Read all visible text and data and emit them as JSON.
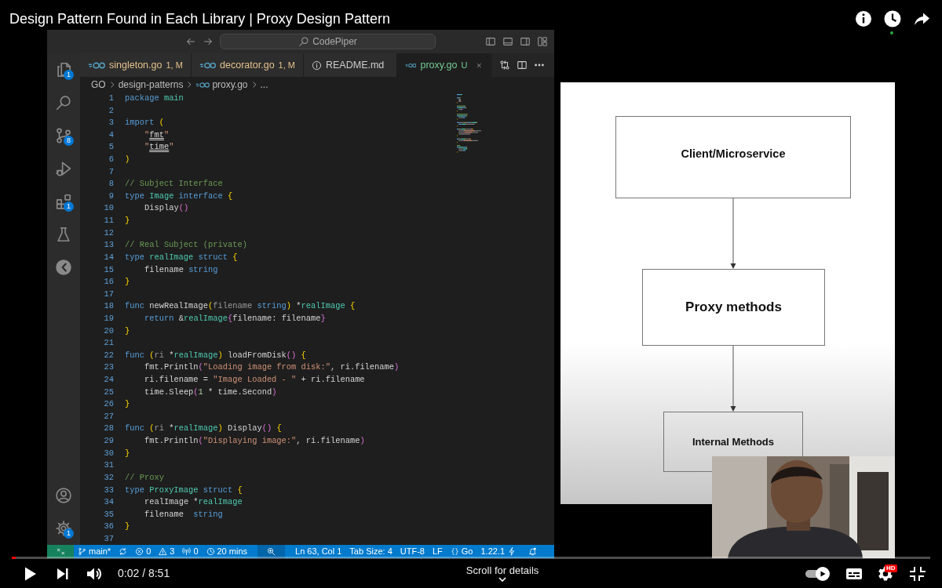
{
  "video": {
    "title": "Design Pattern Found in Each Library | Proxy Design Pattern"
  },
  "editor": {
    "search": "CodePiper",
    "tabs": [
      {
        "label": "singleton.go",
        "kind": "go",
        "decoration": "1, M",
        "color": "#e2c08d",
        "selected": false
      },
      {
        "label": "decorator.go",
        "kind": "go",
        "decoration": "1, M",
        "color": "#e2c08d",
        "selected": false
      },
      {
        "label": "README.md",
        "kind": "markdown",
        "color": "#cccccc",
        "selected": false
      },
      {
        "label": "proxy.go",
        "kind": "go",
        "decoration": "U",
        "color": "#73c991",
        "selected": true
      }
    ],
    "breadcrumbs": [
      {
        "label": "GO",
        "kind": "folder"
      },
      {
        "label": "design-patterns",
        "kind": "folder"
      },
      {
        "label": "proxy.go",
        "kind": "file"
      },
      {
        "label": "...",
        "kind": "symbol"
      }
    ],
    "activity_top": [
      {
        "kind": "explorer",
        "badge": "1"
      },
      {
        "kind": "search"
      },
      {
        "kind": "source-control",
        "badge": "8"
      },
      {
        "kind": "debug"
      },
      {
        "kind": "extensions",
        "badge": "1"
      },
      {
        "kind": "testing"
      },
      {
        "kind": "timeline"
      }
    ],
    "activity_bottom": [
      {
        "kind": "account"
      },
      {
        "kind": "settings",
        "badge": "1"
      }
    ],
    "lines": [
      {
        "n": "1",
        "t": [
          {
            "kind": "keyword",
            "text": "package "
          },
          {
            "kind": "type",
            "text": "main"
          }
        ]
      },
      {
        "n": "2"
      },
      {
        "n": "3",
        "t": [
          {
            "kind": "keyword",
            "text": "import "
          },
          {
            "kind": "bracket",
            "text": "("
          }
        ]
      },
      {
        "n": "4",
        "indent": true,
        "t": [
          {
            "kind": "string",
            "text": "\""
          },
          {
            "kind": "module",
            "text": "fmt"
          },
          {
            "kind": "string",
            "text": "\""
          }
        ]
      },
      {
        "n": "5",
        "indent": true,
        "t": [
          {
            "kind": "string",
            "text": "\""
          },
          {
            "kind": "module",
            "text": "time"
          },
          {
            "kind": "string",
            "text": "\""
          }
        ]
      },
      {
        "n": "6",
        "t": [
          {
            "kind": "bracket",
            "text": ")"
          }
        ]
      },
      {
        "n": "7"
      },
      {
        "n": "8",
        "t": [
          {
            "kind": "comment",
            "text": "// Subject Interface"
          }
        ]
      },
      {
        "n": "9",
        "t": [
          {
            "kind": "keyword",
            "text": "type "
          },
          {
            "kind": "type",
            "text": "Image "
          },
          {
            "kind": "keyword",
            "text": "interface "
          },
          {
            "kind": "bracket",
            "text": "{"
          }
        ]
      },
      {
        "n": "10",
        "indent": true,
        "t": [
          {
            "kind": "plain",
            "text": "Display"
          },
          {
            "kind": "paren",
            "text": "()"
          }
        ]
      },
      {
        "n": "11",
        "t": [
          {
            "kind": "bracket",
            "text": "}"
          }
        ]
      },
      {
        "n": "12"
      },
      {
        "n": "13",
        "t": [
          {
            "kind": "comment",
            "text": "// Real Subject (private)"
          }
        ]
      },
      {
        "n": "14",
        "t": [
          {
            "kind": "keyword",
            "text": "type "
          },
          {
            "kind": "type",
            "text": "realImage "
          },
          {
            "kind": "keyword",
            "text": "struct "
          },
          {
            "kind": "bracket",
            "text": "{"
          }
        ]
      },
      {
        "n": "15",
        "indent": true,
        "t": [
          {
            "kind": "plain",
            "text": "filename "
          },
          {
            "kind": "keyword",
            "text": "string"
          }
        ]
      },
      {
        "n": "16",
        "t": [
          {
            "kind": "bracket",
            "text": "}"
          }
        ]
      },
      {
        "n": "17"
      },
      {
        "n": "18",
        "t": [
          {
            "kind": "keyword",
            "text": "func "
          },
          {
            "kind": "plain",
            "text": "newRealImage"
          },
          {
            "kind": "bracket",
            "text": "("
          },
          {
            "kind": "param",
            "text": "filename "
          },
          {
            "kind": "keyword",
            "text": "string"
          },
          {
            "kind": "bracket",
            "text": ")"
          },
          {
            "kind": "plain",
            "text": " *"
          },
          {
            "kind": "type",
            "text": "realImage "
          },
          {
            "kind": "bracket",
            "text": "{"
          }
        ]
      },
      {
        "n": "19",
        "indent": true,
        "t": [
          {
            "kind": "keyword",
            "text": "return "
          },
          {
            "kind": "plain",
            "text": "&"
          },
          {
            "kind": "type",
            "text": "realImage"
          },
          {
            "kind": "paren",
            "text": "{"
          },
          {
            "kind": "plain",
            "text": "filename: filename"
          },
          {
            "kind": "paren",
            "text": "}"
          }
        ]
      },
      {
        "n": "20",
        "t": [
          {
            "kind": "bracket",
            "text": "}"
          }
        ]
      },
      {
        "n": "21"
      },
      {
        "n": "22",
        "t": [
          {
            "kind": "keyword",
            "text": "func "
          },
          {
            "kind": "bracket",
            "text": "("
          },
          {
            "kind": "param",
            "text": "ri "
          },
          {
            "kind": "plain",
            "text": "*"
          },
          {
            "kind": "type",
            "text": "realImage"
          },
          {
            "kind": "bracket",
            "text": ")"
          },
          {
            "kind": "plain",
            "text": " loadFromDisk"
          },
          {
            "kind": "paren",
            "text": "()"
          },
          {
            "kind": "bracket",
            "text": " {"
          }
        ]
      },
      {
        "n": "23",
        "indent": true,
        "t": [
          {
            "kind": "plain",
            "text": "fmt.Println"
          },
          {
            "kind": "paren",
            "text": "("
          },
          {
            "kind": "string",
            "text": "\"Loading image from disk:\""
          },
          {
            "kind": "plain",
            "text": ", ri.filename"
          },
          {
            "kind": "paren",
            "text": ")"
          }
        ]
      },
      {
        "n": "24",
        "indent": true,
        "t": [
          {
            "kind": "plain",
            "text": "ri.filename = "
          },
          {
            "kind": "string",
            "text": "\"Image Loaded - \""
          },
          {
            "kind": "plain",
            "text": " + ri.filename"
          }
        ]
      },
      {
        "n": "25",
        "indent": true,
        "t": [
          {
            "kind": "plain",
            "text": "time.Sleep"
          },
          {
            "kind": "paren",
            "text": "("
          },
          {
            "kind": "number",
            "text": "1"
          },
          {
            "kind": "plain",
            "text": " * time.Second"
          },
          {
            "kind": "paren",
            "text": ")"
          }
        ]
      },
      {
        "n": "26",
        "t": [
          {
            "kind": "bracket",
            "text": "}"
          }
        ]
      },
      {
        "n": "27"
      },
      {
        "n": "28",
        "t": [
          {
            "kind": "keyword",
            "text": "func "
          },
          {
            "kind": "bracket",
            "text": "("
          },
          {
            "kind": "param",
            "text": "ri "
          },
          {
            "kind": "plain",
            "text": "*"
          },
          {
            "kind": "type",
            "text": "realImage"
          },
          {
            "kind": "bracket",
            "text": ")"
          },
          {
            "kind": "plain",
            "text": " Display"
          },
          {
            "kind": "paren",
            "text": "()"
          },
          {
            "kind": "bracket",
            "text": " {"
          }
        ]
      },
      {
        "n": "29",
        "indent": true,
        "t": [
          {
            "kind": "plain",
            "text": "fmt.Println"
          },
          {
            "kind": "paren",
            "text": "("
          },
          {
            "kind": "string",
            "text": "\"Displaying image:\""
          },
          {
            "kind": "plain",
            "text": ", ri.filename"
          },
          {
            "kind": "paren",
            "text": ")"
          }
        ]
      },
      {
        "n": "30",
        "t": [
          {
            "kind": "bracket",
            "text": "}"
          }
        ]
      },
      {
        "n": "31"
      },
      {
        "n": "32",
        "t": [
          {
            "kind": "comment",
            "text": "// Proxy"
          }
        ]
      },
      {
        "n": "33",
        "t": [
          {
            "kind": "keyword",
            "text": "type "
          },
          {
            "kind": "type",
            "text": "ProxyImage "
          },
          {
            "kind": "keyword",
            "text": "struct "
          },
          {
            "kind": "bracket",
            "text": "{"
          }
        ]
      },
      {
        "n": "34",
        "indent": true,
        "t": [
          {
            "kind": "plain",
            "text": "realImage *"
          },
          {
            "kind": "type",
            "text": "realImage"
          }
        ]
      },
      {
        "n": "35",
        "indent": true,
        "t": [
          {
            "kind": "plain",
            "text": "filename  "
          },
          {
            "kind": "keyword",
            "text": "string"
          }
        ]
      },
      {
        "n": "36",
        "t": [
          {
            "kind": "bracket",
            "text": "}"
          }
        ]
      },
      {
        "n": "37"
      }
    ],
    "status_bar": [
      {
        "kind": "remote"
      },
      {
        "kind": "branch",
        "text": "main*"
      },
      {
        "kind": "sync"
      },
      {
        "kind": "error",
        "text": "0"
      },
      {
        "kind": "warning",
        "text": "3"
      },
      {
        "kind": "ports",
        "text": "0"
      },
      {
        "kind": "clock",
        "text": "20 mins"
      },
      {
        "kind": "zoom"
      },
      {
        "kind": "text",
        "text": "Ln 63, Col 1"
      },
      {
        "kind": "text",
        "text": "Tab Size: 4"
      },
      {
        "kind": "text",
        "text": "UTF-8"
      },
      {
        "kind": "text",
        "text": "LF"
      },
      {
        "kind": "language",
        "text": "Go"
      },
      {
        "kind": "version",
        "text": "1.22.1"
      },
      {
        "kind": "bell"
      }
    ]
  },
  "diagram": {
    "nodes": [
      {
        "label": "Client/Microservice"
      },
      {
        "label": "Proxy methods"
      },
      {
        "label": "Internal Methods"
      }
    ]
  },
  "player": {
    "progress": {
      "level": 0.004
    },
    "time": "0:02 / 8:51",
    "hint": "Scroll for details",
    "autoplay": {
      "on": true
    },
    "quality_badge": "HD"
  }
}
